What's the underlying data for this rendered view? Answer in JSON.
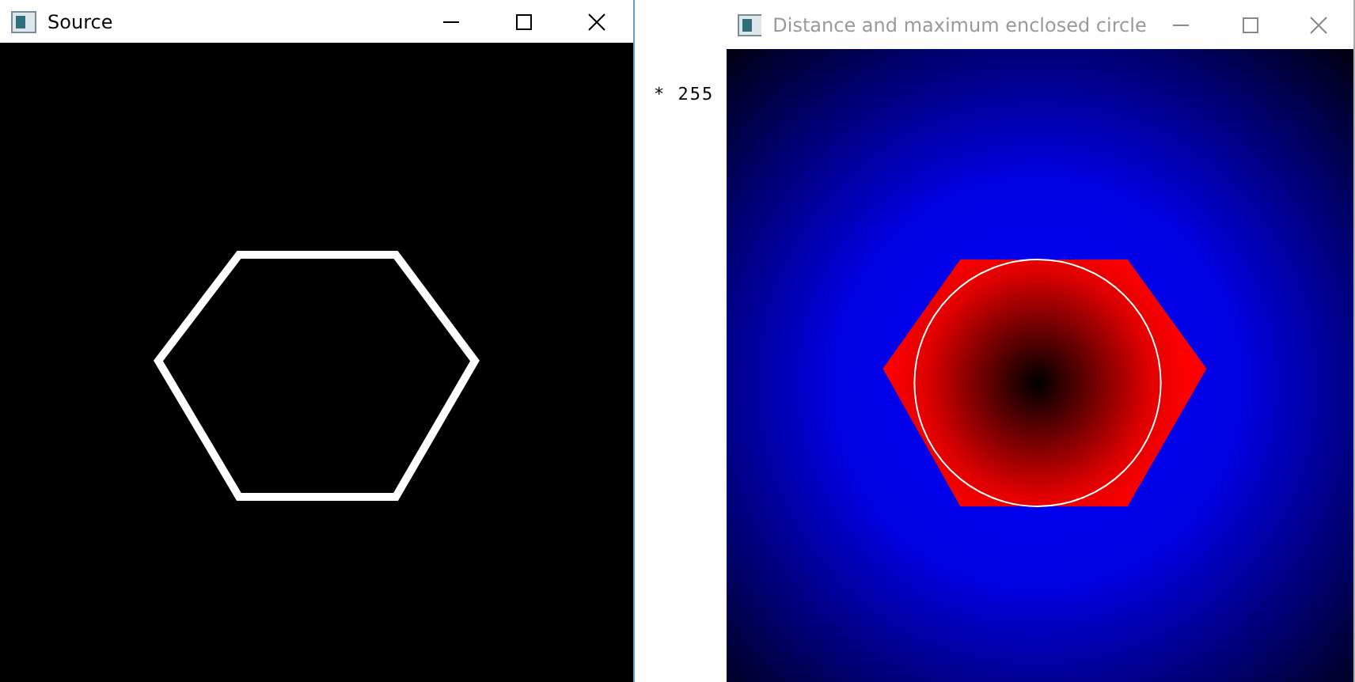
{
  "windows": [
    {
      "title": "Source",
      "active": true,
      "kind": "source"
    },
    {
      "title": "Distance and maximum enclosed circle",
      "active": false,
      "kind": "distance"
    }
  ],
  "background_text": "* 255"
}
